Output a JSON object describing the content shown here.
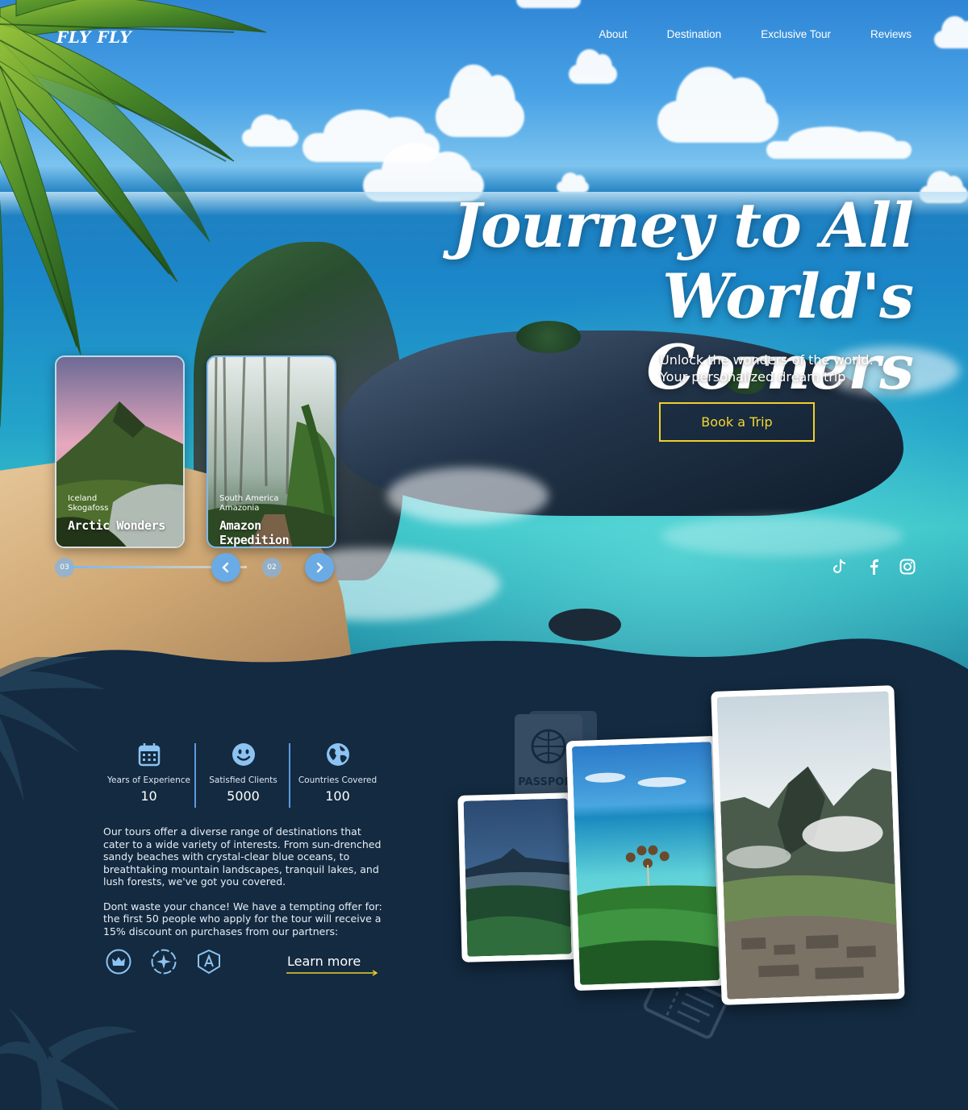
{
  "brand": {
    "logo": "FLY FLY"
  },
  "nav": {
    "items": [
      "About",
      "Destination",
      "Exclusive Tour",
      "Reviews"
    ]
  },
  "hero": {
    "headline_line1": "Journey to All World's",
    "headline_line2": "Corners",
    "subline_1": "Unlock the wonders of the world:",
    "subline_2": "Your personalized dream trip",
    "cta": "Book a Trip"
  },
  "cards": [
    {
      "country": "Iceland",
      "place": "Skogafoss",
      "title": "Arctic Wonders"
    },
    {
      "country": "South America",
      "place": "Amazonia",
      "title": "Amazon Expedition"
    }
  ],
  "slider": {
    "index_left": "03",
    "index_right": "02"
  },
  "socials": [
    "tiktok-icon",
    "facebook-icon",
    "instagram-icon"
  ],
  "stats": [
    {
      "icon": "calendar-icon",
      "label": "Years of Experience",
      "value": "10"
    },
    {
      "icon": "smiley-icon",
      "label": "Satisfied Clients",
      "value": "5000"
    },
    {
      "icon": "globe-icon",
      "label": "Countries Covered",
      "value": "100"
    }
  ],
  "about": {
    "paragraph1": "Our tours offer a diverse range of destinations that cater to a wide variety of interests. From sun-drenched sandy beaches with crystal-clear blue oceans, to breathtaking mountain landscapes, tranquil lakes, and lush forests, we've got you covered.",
    "paragraph2": "Dont waste your chance! We have a tempting offer for: the first 50 people who apply for the tour will receive a 15% discount on purchases from our partners:",
    "learn_more": "Learn more",
    "passport_text": "PASSPORT"
  },
  "partners": [
    "crown-icon",
    "star-badge-icon",
    "letter-a-shield-icon"
  ],
  "colors": {
    "accent": "#f1cf2a",
    "dark_bg": "#132a40",
    "stat_blue": "#8cc3f2",
    "button_blue": "#6aaae5"
  }
}
